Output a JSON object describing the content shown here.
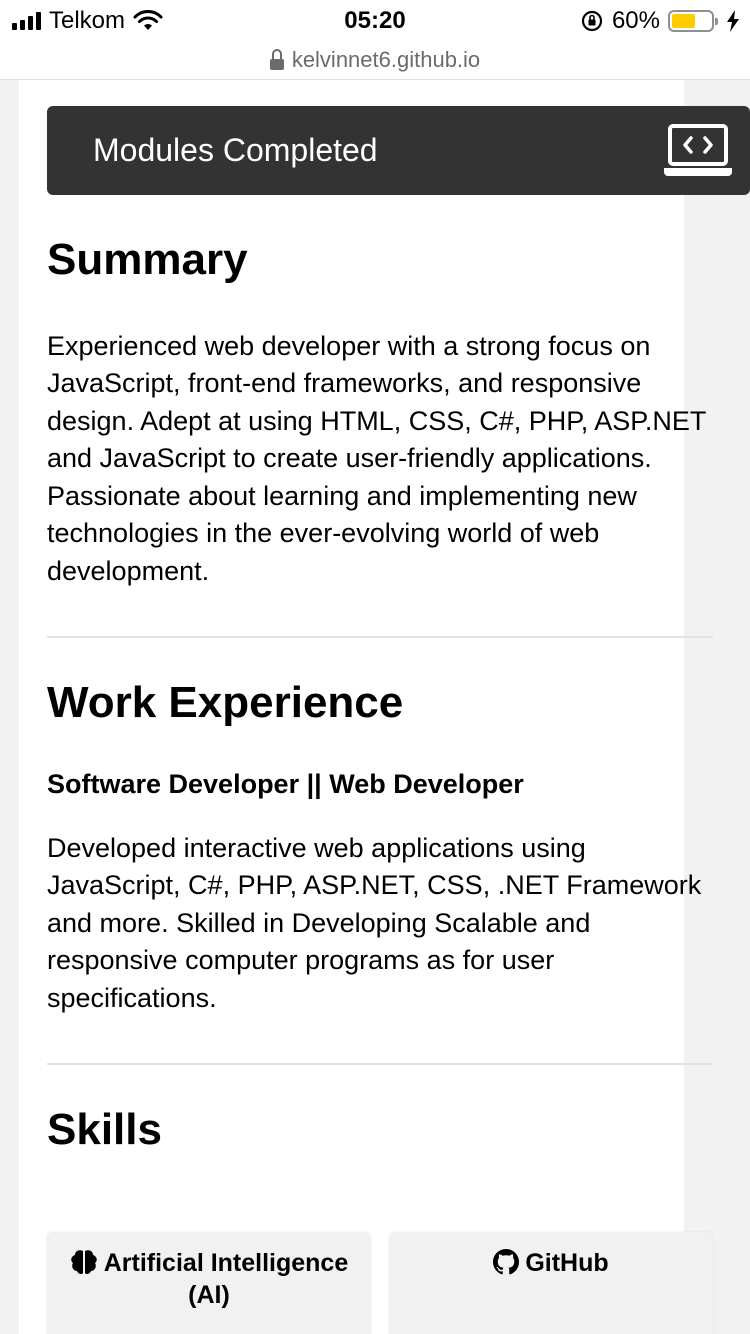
{
  "status_bar": {
    "carrier": "Telkom",
    "time": "05:20",
    "battery_percent": "60%",
    "battery_level": 0.6,
    "icons": [
      "signal-icon",
      "wifi-icon",
      "rotation-lock-icon",
      "battery-icon",
      "charging-bolt-icon"
    ]
  },
  "browser": {
    "url": "kelvinnet6.github.io",
    "lock_icon": "lock-icon"
  },
  "modules_bar": {
    "label": "Modules Completed",
    "icon": "laptop-code-icon"
  },
  "summary": {
    "title": "Summary",
    "text": "Experienced web developer with a strong focus on JavaScript, front-end frameworks, and responsive design. Adept at using HTML, CSS, C#, PHP, ASP.NET and JavaScript to create user-friendly applications. Passionate about learning and implementing new technologies in the ever-evolving world of web development."
  },
  "work_experience": {
    "title": "Work Experience",
    "job_title": "Software Developer || Web Developer",
    "description": "Developed interactive web applications using JavaScript, C#, PHP, ASP.NET, CSS, .NET Framework and more. Skilled in Developing Scalable and responsive computer programs as for user specifications."
  },
  "skills": {
    "title": "Skills",
    "items": [
      {
        "label": "Artificial Intelligence (AI)",
        "icon": "brain-icon"
      },
      {
        "label": "GitHub",
        "icon": "github-icon"
      }
    ]
  },
  "colors": {
    "modules_bar_bg": "#333333",
    "battery_fill": "#ffcc00",
    "skill_card_bg": "#f1f1f1"
  }
}
